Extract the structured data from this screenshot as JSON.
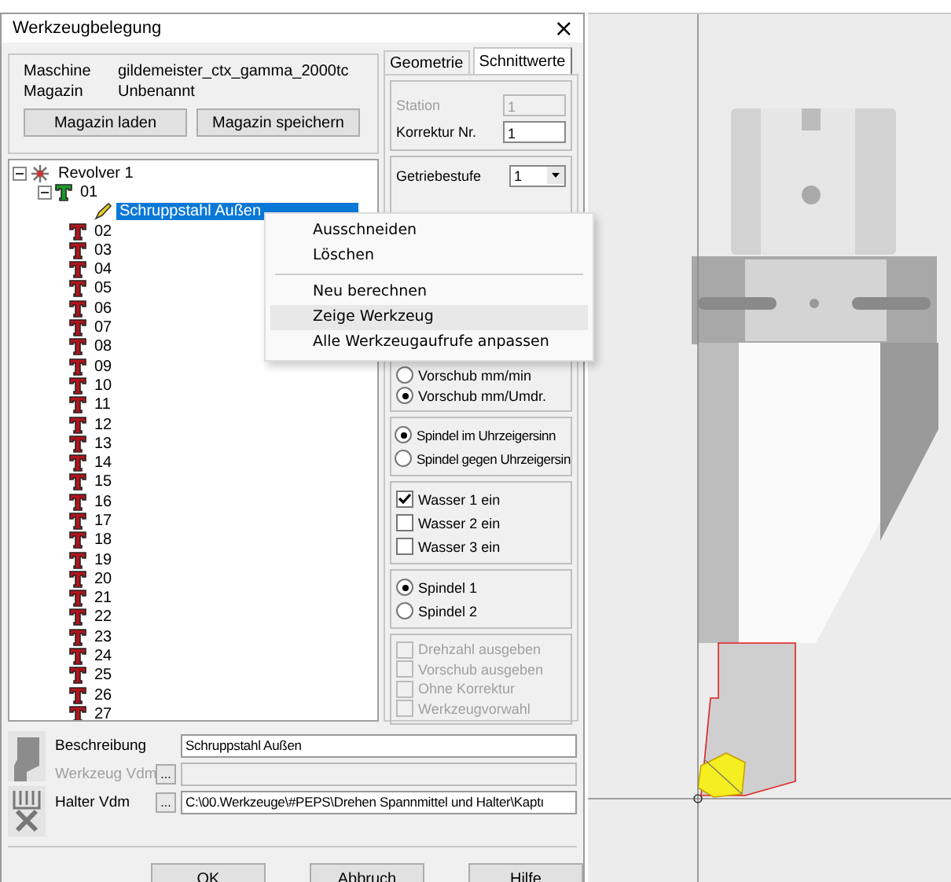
{
  "window": {
    "title": "Werkzeugbelegung",
    "close": "×"
  },
  "machine_info": [
    {
      "label": "Maschine",
      "value": "gildemeister_ctx_gamma_2000tc"
    },
    {
      "label": "Magazin",
      "value": "Unbenannt"
    }
  ],
  "magazine_buttons": [
    "Magazin laden",
    "Magazin speichern"
  ],
  "tree": {
    "label": "Revolver 1",
    "kind": "turret",
    "expanded": true,
    "selected": false,
    "children": [
      {
        "label": "01",
        "kind": "station",
        "loaded": true,
        "expanded": true,
        "selected": false,
        "children": [
          {
            "label": "Schruppstahl Außen",
            "kind": "tool",
            "selected": true
          }
        ]
      },
      {
        "label": "02",
        "kind": "station",
        "loaded": false,
        "selected": false
      },
      {
        "label": "03",
        "kind": "station",
        "loaded": false,
        "selected": false
      },
      {
        "label": "04",
        "kind": "station",
        "loaded": false,
        "selected": false
      },
      {
        "label": "05",
        "kind": "station",
        "loaded": false,
        "selected": false
      },
      {
        "label": "06",
        "kind": "station",
        "loaded": false,
        "selected": false
      },
      {
        "label": "07",
        "kind": "station",
        "loaded": false,
        "selected": false
      },
      {
        "label": "08",
        "kind": "station",
        "loaded": false,
        "selected": false
      },
      {
        "label": "09",
        "kind": "station",
        "loaded": false,
        "selected": false
      },
      {
        "label": "10",
        "kind": "station",
        "loaded": false,
        "selected": false
      },
      {
        "label": "11",
        "kind": "station",
        "loaded": false,
        "selected": false
      },
      {
        "label": "12",
        "kind": "station",
        "loaded": false,
        "selected": false
      },
      {
        "label": "13",
        "kind": "station",
        "loaded": false,
        "selected": false
      },
      {
        "label": "14",
        "kind": "station",
        "loaded": false,
        "selected": false
      },
      {
        "label": "15",
        "kind": "station",
        "loaded": false,
        "selected": false
      },
      {
        "label": "16",
        "kind": "station",
        "loaded": false,
        "selected": false
      },
      {
        "label": "17",
        "kind": "station",
        "loaded": false,
        "selected": false
      },
      {
        "label": "18",
        "kind": "station",
        "loaded": false,
        "selected": false
      },
      {
        "label": "19",
        "kind": "station",
        "loaded": false,
        "selected": false
      },
      {
        "label": "20",
        "kind": "station",
        "loaded": false,
        "selected": false
      },
      {
        "label": "21",
        "kind": "station",
        "loaded": false,
        "selected": false
      },
      {
        "label": "22",
        "kind": "station",
        "loaded": false,
        "selected": false
      },
      {
        "label": "23",
        "kind": "station",
        "loaded": false,
        "selected": false
      },
      {
        "label": "24",
        "kind": "station",
        "loaded": false,
        "selected": false
      },
      {
        "label": "25",
        "kind": "station",
        "loaded": false,
        "selected": false
      },
      {
        "label": "26",
        "kind": "station",
        "loaded": false,
        "selected": false
      },
      {
        "label": "27",
        "kind": "station",
        "loaded": false,
        "selected": false
      }
    ]
  },
  "tabs": [
    {
      "label": "Geometrie",
      "selected": false
    },
    {
      "label": "Schnittwerte",
      "selected": true
    }
  ],
  "station_fields": [
    {
      "label": "Station",
      "value": "1",
      "disabled": true
    },
    {
      "label": "Korrektur Nr.",
      "value": "1",
      "disabled": false
    }
  ],
  "gear": {
    "label": "Getriebestufe",
    "value": "1"
  },
  "feed_options": [
    {
      "label": "Vorschub mm/min",
      "selected": false
    },
    {
      "label": "Vorschub mm/Umdr.",
      "selected": true
    }
  ],
  "spindle_direction": [
    {
      "label": "Spindel im Uhrzeigersinn",
      "selected": true
    },
    {
      "label": "Spindel gegen Uhrzeigersin",
      "selected": false
    }
  ],
  "coolant": [
    {
      "label": "Wasser 1 ein",
      "checked": true
    },
    {
      "label": "Wasser 2 ein",
      "checked": false
    },
    {
      "label": "Wasser 3 ein",
      "checked": false
    }
  ],
  "spindle": [
    {
      "label": "Spindel 1",
      "selected": true
    },
    {
      "label": "Spindel 2",
      "selected": false
    }
  ],
  "output_options": [
    {
      "label": "Drehzahl ausgeben",
      "checked": false,
      "disabled": true
    },
    {
      "label": "Vorschub ausgeben",
      "checked": false,
      "disabled": true
    },
    {
      "label": "Ohne Korrektur",
      "checked": false,
      "disabled": true
    },
    {
      "label": "Werkzeugvorwahl",
      "checked": false,
      "disabled": true
    }
  ],
  "context_menu": [
    {
      "kind": "item",
      "label": "Ausschneiden",
      "selected": false
    },
    {
      "kind": "item",
      "label": "Löschen",
      "selected": false
    },
    {
      "kind": "separator"
    },
    {
      "kind": "item",
      "label": "Neu berechnen",
      "selected": false
    },
    {
      "kind": "item",
      "label": "Zeige Werkzeug",
      "selected": true
    },
    {
      "kind": "item",
      "label": "Alle Werkzeugaufrufe anpassen",
      "selected": false
    }
  ],
  "details": [
    {
      "label": "Beschreibung",
      "value": "Schruppstahl Außen",
      "disabled": false
    },
    {
      "label": "Werkzeug Vdm",
      "button": "...",
      "disabled": true
    },
    {
      "label": "Halter Vdm",
      "button": "...",
      "value": "C:\\00.Werkzeuge\\#PEPS\\Drehen Spannmittel und Halter\\Kaptı",
      "disabled": false
    }
  ],
  "dialog_buttons": [
    "OK",
    "Abbruch",
    "Hilfe"
  ]
}
